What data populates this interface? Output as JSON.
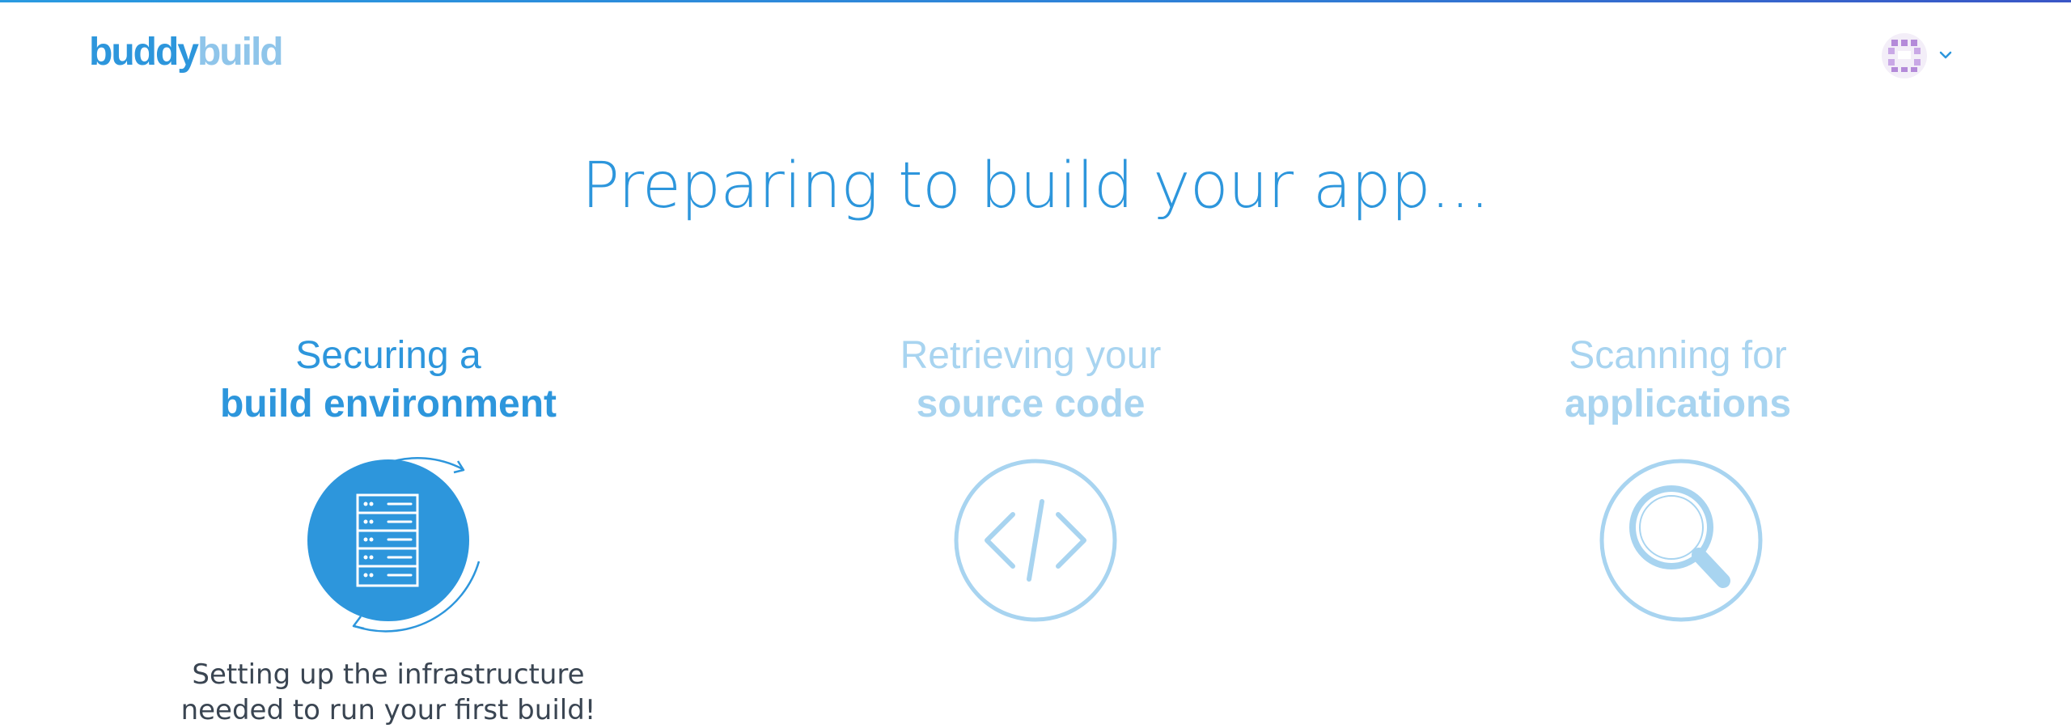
{
  "header": {
    "logo_part1": "buddy",
    "logo_part2": "build"
  },
  "page_title": "Preparing to build your app...",
  "steps": [
    {
      "title_light": "Securing a",
      "title_bold": "build environment",
      "icon": "server-rack-icon",
      "state": "active",
      "description_line1": "Setting up the infrastructure",
      "description_line2": "needed to run your first build!"
    },
    {
      "title_light": "Retrieving your",
      "title_bold": "source code",
      "icon": "code-brackets-icon",
      "state": "inactive"
    },
    {
      "title_light": "Scanning for",
      "title_bold": "applications",
      "icon": "magnifier-icon",
      "state": "inactive"
    }
  ],
  "colors": {
    "accent": "#2d96dc",
    "accent_light": "#a8d4f0",
    "text_dark": "#3a4552"
  }
}
